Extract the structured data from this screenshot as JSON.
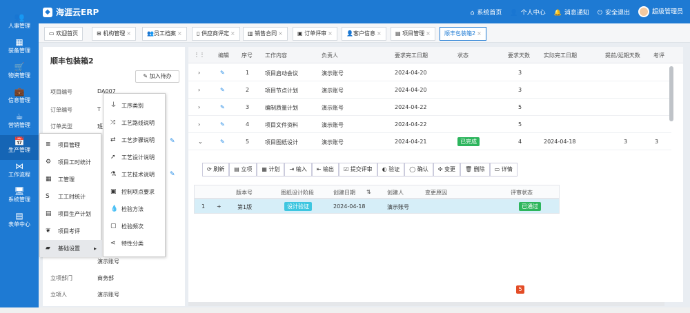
{
  "app": {
    "title": "海涯云ERP",
    "logo_icon": "logo-icon"
  },
  "topnav": {
    "home": "系统首页",
    "profile": "个人中心",
    "messages": "消息通知",
    "logout": "安全退出",
    "user": "超级管理员"
  },
  "sidebar": [
    {
      "label": "人事管理",
      "icon": "users-icon"
    },
    {
      "label": "装备管理",
      "icon": "equipment-icon"
    },
    {
      "label": "物资管理",
      "icon": "cart-icon"
    },
    {
      "label": "信息管理",
      "icon": "briefcase-icon"
    },
    {
      "label": "营销管理",
      "icon": "coffee-icon"
    },
    {
      "label": "生产管理",
      "icon": "calendar-icon"
    },
    {
      "label": "工作流程",
      "icon": "share-icon"
    },
    {
      "label": "系统管理",
      "icon": "monitor-icon"
    },
    {
      "label": "表单中心",
      "icon": "table-icon"
    }
  ],
  "tabs": [
    "欢迎首页",
    "机构管理",
    "员工档案",
    "供应商评定",
    "销售合同",
    "订单评审",
    "客户信息",
    "项目管理",
    "顺丰包装箱2"
  ],
  "left": {
    "title": "顺丰包装箱2",
    "todo_button": "加入待办",
    "fields": [
      {
        "label": "项目编号",
        "value": "DA007"
      },
      {
        "label": "订单编号",
        "value": "T"
      },
      {
        "label": "订单类型",
        "value": "班"
      },
      {
        "label": "",
        "value": "演示账号"
      },
      {
        "label": "立项部门",
        "value": "商务部"
      },
      {
        "label": "立项人",
        "value": "演示账号"
      }
    ]
  },
  "grid": {
    "headers": [
      "编辑",
      "序号",
      "工作内容",
      "负责人",
      "要求完工日期",
      "状态",
      "要求天数",
      "实际完工日期",
      "提前/延期天数",
      "考评"
    ],
    "rows": [
      {
        "no": "1",
        "work": "项目启动会议",
        "owner": "演示账号",
        "due": "2024-04-20",
        "status": "",
        "days": "3",
        "actual": "",
        "delay": "",
        "eval": ""
      },
      {
        "no": "2",
        "work": "项目节点计划",
        "owner": "演示账号",
        "due": "2024-04-20",
        "status": "",
        "days": "3",
        "actual": "",
        "delay": "",
        "eval": ""
      },
      {
        "no": "3",
        "work": "编制质量计划",
        "owner": "演示账号",
        "due": "2024-04-22",
        "status": "",
        "days": "5",
        "actual": "",
        "delay": "",
        "eval": ""
      },
      {
        "no": "4",
        "work": "项目文件资料",
        "owner": "演示账号",
        "due": "2024-04-22",
        "status": "",
        "days": "5",
        "actual": "",
        "delay": "",
        "eval": ""
      },
      {
        "no": "5",
        "work": "项目图纸设计",
        "owner": "演示账号",
        "due": "2024-04-21",
        "status": "已完成",
        "days": "4",
        "actual": "2024-04-18",
        "delay": "3",
        "eval": "3"
      }
    ]
  },
  "subtoolbar": [
    "刷新",
    "立项",
    "计划",
    "输入",
    "输出",
    "提交评审",
    "验证",
    "确认",
    "变更",
    "删除",
    "详情"
  ],
  "subgrid": {
    "headers": [
      "版本号",
      "图纸设计阶段",
      "创建日期",
      "创建人",
      "变更原因",
      "评审状态"
    ],
    "row": {
      "idx": "1",
      "version": "第1版",
      "stage": "设计验证",
      "date": "2024-04-18",
      "creator": "演示账号",
      "reason": "",
      "review": "已通过"
    }
  },
  "menu1": [
    "项目管理",
    "项目工时统计",
    "工管理",
    "工工时统计",
    "项目生产计划",
    "项目考评",
    "基础设置"
  ],
  "menu2": [
    "工序类别",
    "工艺路线说明",
    "工艺步骤说明",
    "工艺设计说明",
    "工艺技术说明",
    "控制项点要求",
    "检验方法",
    "检验频次",
    "特性分类"
  ]
}
